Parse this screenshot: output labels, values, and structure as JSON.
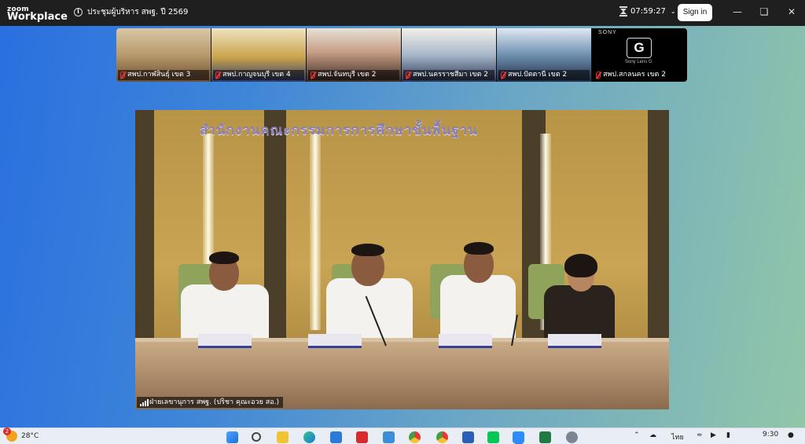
{
  "app": {
    "brand_line1": "zoom",
    "brand_line2": "Workplace",
    "meeting_title": "ประชุมผู้บริหาร สพฐ. ปี 2569",
    "elapsed_time": "07:59:27",
    "sign_in_label": "Sign in",
    "window_controls": [
      "minimize-icon",
      "restore-icon",
      "close-icon"
    ]
  },
  "participants": [
    {
      "label": "สพป.กาฬสินธุ์ เขต 3",
      "muted": true
    },
    {
      "label": "สพป.กาญจนบุรี เขต 4",
      "muted": true
    },
    {
      "label": "สพป.จันทบุรี เขต 2",
      "muted": true
    },
    {
      "label": "สพป.นครราชสีมา เขต 2",
      "muted": true
    },
    {
      "label": "สพป.ปัตตานี เขต 2",
      "muted": true
    },
    {
      "label": "สพป.สกลนคร เขต 2",
      "muted": true
    }
  ],
  "camera_overlay": {
    "brand": "SONY",
    "logo_letter": "G",
    "caption": "Sony Lens G"
  },
  "main_video": {
    "wall_sign": "สำนักงานคณะกรรมการการศึกษาขั้นพื้นฐาน",
    "speaker_label": "ฝ่ายเลขานุการ สพฐ. (ปริชา  คุณะอวย สอ.)"
  },
  "taskbar": {
    "temperature": "28°C",
    "notification_count": "2",
    "language": "ไทย",
    "clock": "9:30",
    "pinned_apps": [
      "windows-start-icon",
      "search-icon",
      "file-explorer-icon",
      "edge-icon",
      "store-icon",
      "acrobat-icon",
      "briefcase-icon",
      "chrome-icon",
      "chrome-alt-icon",
      "word-icon",
      "line-icon",
      "zoom-icon",
      "excel-icon",
      "settings-icon"
    ]
  },
  "colors": {
    "title_bar": "#1f1f1f",
    "nameplate_accent": "#3a3f9e",
    "muted_red": "#e33333"
  }
}
